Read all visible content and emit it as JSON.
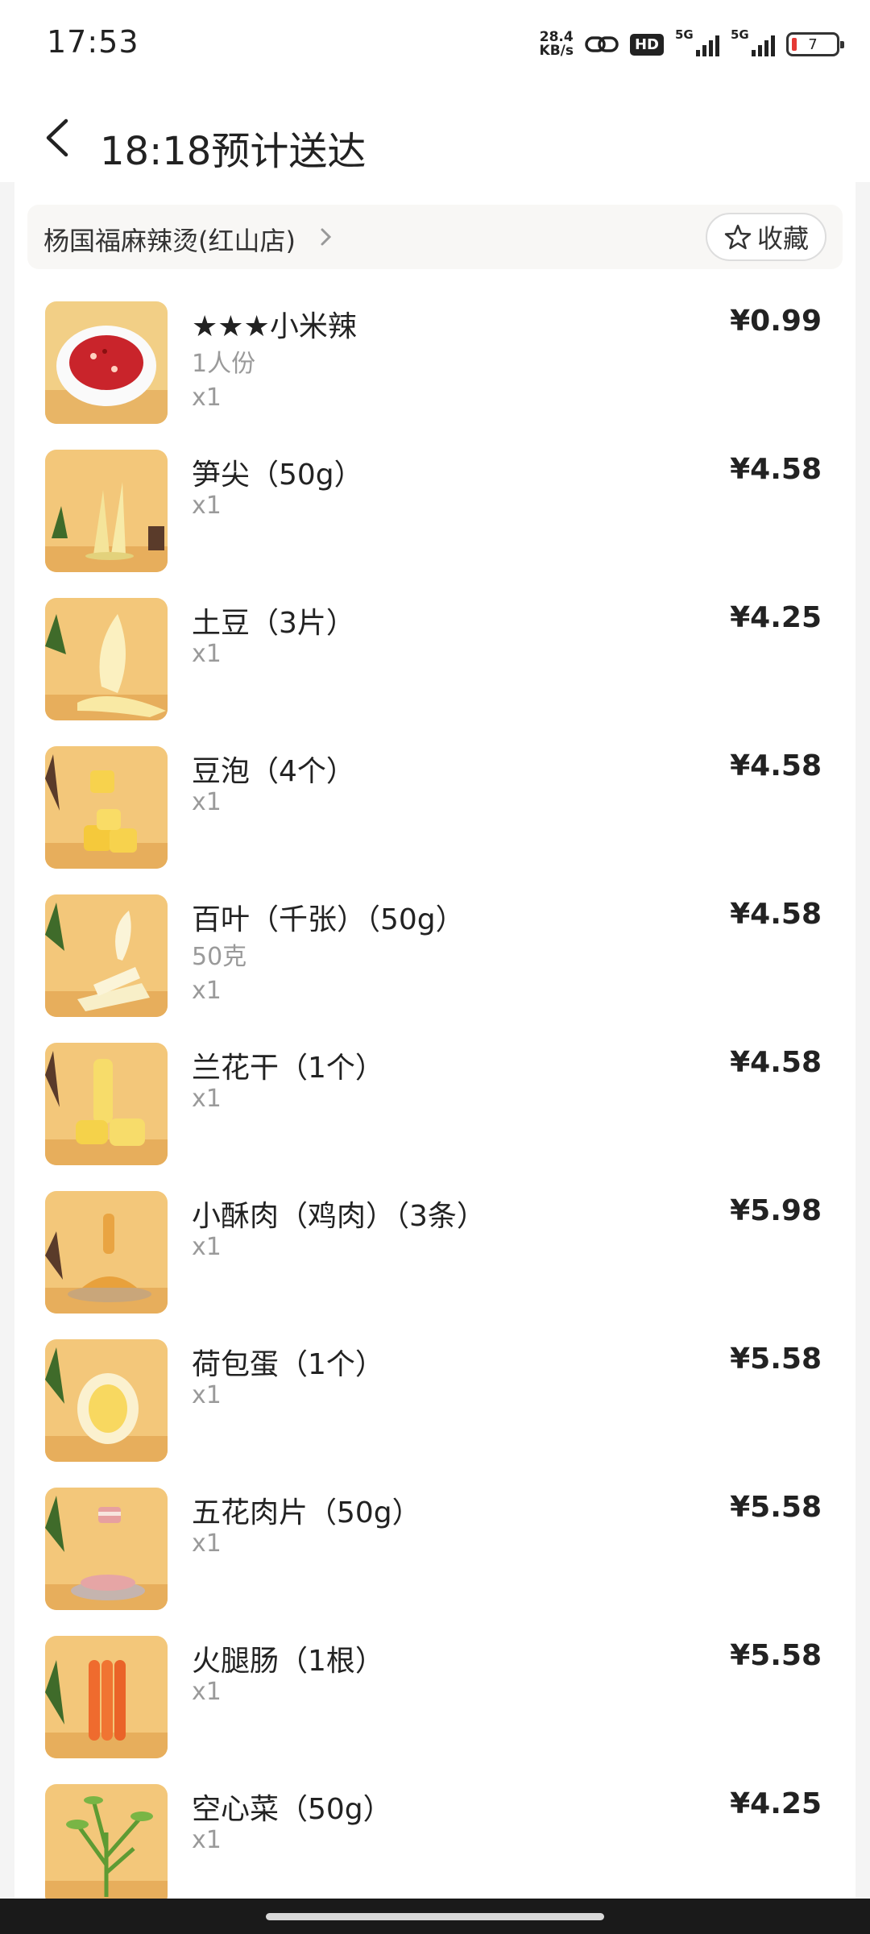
{
  "status_bar": {
    "time": "17:53",
    "net_speed_value": "28.4",
    "net_speed_unit": "KB/s",
    "hd_label": "HD",
    "signal_1_label": "5G",
    "signal_2_label": "5G",
    "battery_level": "7"
  },
  "header": {
    "title": "18:18预计送达"
  },
  "store": {
    "name": "杨国福麻辣烫(红山店)",
    "favorite_label": "收藏"
  },
  "colors": {
    "accent_red": "#e53935",
    "thumb_bg": "#f3c77a"
  },
  "items": [
    {
      "name": "★★★小米辣",
      "spec": "1人份",
      "qty": "x1",
      "price": "¥0.99",
      "icon": "chili-image"
    },
    {
      "name": "笋尖（50g）",
      "spec": "",
      "qty": "x1",
      "price": "¥4.58",
      "icon": "bamboo-shoot-image"
    },
    {
      "name": "土豆（3片）",
      "spec": "",
      "qty": "x1",
      "price": "¥4.25",
      "icon": "potato-slice-image"
    },
    {
      "name": "豆泡（4个）",
      "spec": "",
      "qty": "x1",
      "price": "¥4.58",
      "icon": "tofu-puff-image"
    },
    {
      "name": "百叶（千张）（50g）",
      "spec": "50克",
      "qty": "x1",
      "price": "¥4.58",
      "icon": "tofu-skin-image"
    },
    {
      "name": "兰花干（1个）",
      "spec": "",
      "qty": "x1",
      "price": "¥4.58",
      "icon": "dried-tofu-image"
    },
    {
      "name": "小酥肉（鸡肉）（3条）",
      "spec": "",
      "qty": "x1",
      "price": "¥5.98",
      "icon": "crispy-meat-image"
    },
    {
      "name": "荷包蛋（1个）",
      "spec": "",
      "qty": "x1",
      "price": "¥5.58",
      "icon": "fried-egg-image"
    },
    {
      "name": "五花肉片（50g）",
      "spec": "",
      "qty": "x1",
      "price": "¥5.58",
      "icon": "pork-belly-image"
    },
    {
      "name": "火腿肠（1根）",
      "spec": "",
      "qty": "x1",
      "price": "¥5.58",
      "icon": "sausage-image"
    },
    {
      "name": "空心菜（50g）",
      "spec": "",
      "qty": "x1",
      "price": "¥4.25",
      "icon": "water-spinach-image"
    }
  ]
}
